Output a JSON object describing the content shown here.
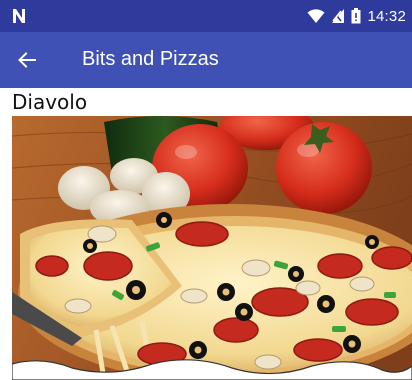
{
  "status_bar": {
    "carrier_glyph": "N",
    "time": "14:32",
    "icons": [
      "wifi-icon",
      "signal-icon",
      "battery-icon"
    ],
    "background": "#2e3a9c"
  },
  "app_bar": {
    "title": "Bits and Pizzas",
    "back_icon": "arrow-back-icon",
    "background": "#3f51b5"
  },
  "pizza": {
    "name": "Diavolo",
    "image": "pizza-photo"
  }
}
